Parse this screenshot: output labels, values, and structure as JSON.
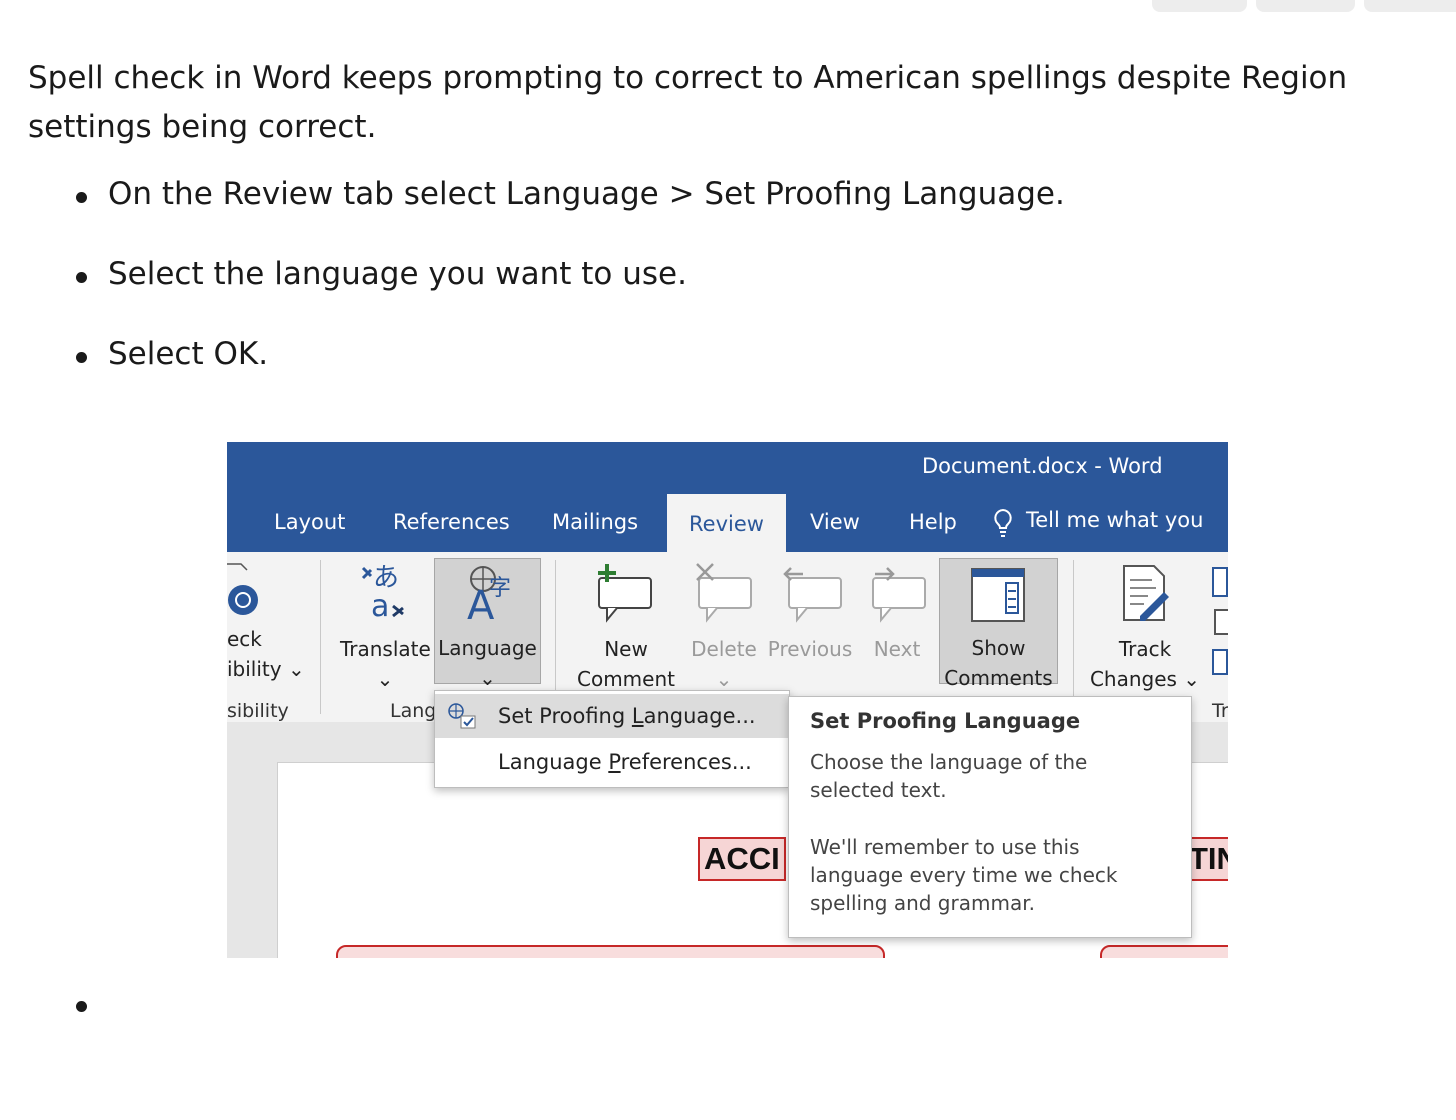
{
  "intro": "Spell check in Word keeps prompting to correct to American spellings despite Region settings being correct.",
  "steps": [
    "On the Review tab select Language > Set Proofing Language.",
    "Select the language you want to use.",
    "Select OK."
  ],
  "screenshot": {
    "title": "Document.docx  -  Word",
    "tabs": [
      "Layout",
      "References",
      "Mailings",
      "Review",
      "View",
      "Help"
    ],
    "active_tab": "Review",
    "tell_me": "Tell me what you",
    "ribbon": {
      "check_accessibility": [
        "eck",
        "ibility ⌄"
      ],
      "accessibility_group": "sibility",
      "translate": "Translate",
      "language": "Language",
      "language_group": "Lang",
      "new_comment": [
        "New",
        "Comment"
      ],
      "delete": "Delete",
      "previous": "Previous",
      "next": "Next",
      "show_comments": [
        "Show",
        "Comments"
      ],
      "track_changes": [
        "Track",
        "Changes ⌄"
      ],
      "tracking_group": "Tr"
    },
    "menu": {
      "set_proofing_pre": "Set Proofing ",
      "set_proofing_u": "L",
      "set_proofing_post": "anguage...",
      "preferences_pre": "Language ",
      "preferences_u": "P",
      "preferences_post": "references..."
    },
    "tooltip": {
      "title": "Set Proofing Language",
      "p1": "Choose the language of the selected text.",
      "p2": "We'll remember to use this language every time we check spelling and grammar."
    },
    "document": {
      "heading_left": "ACCI",
      "heading_right": "TIN"
    }
  }
}
